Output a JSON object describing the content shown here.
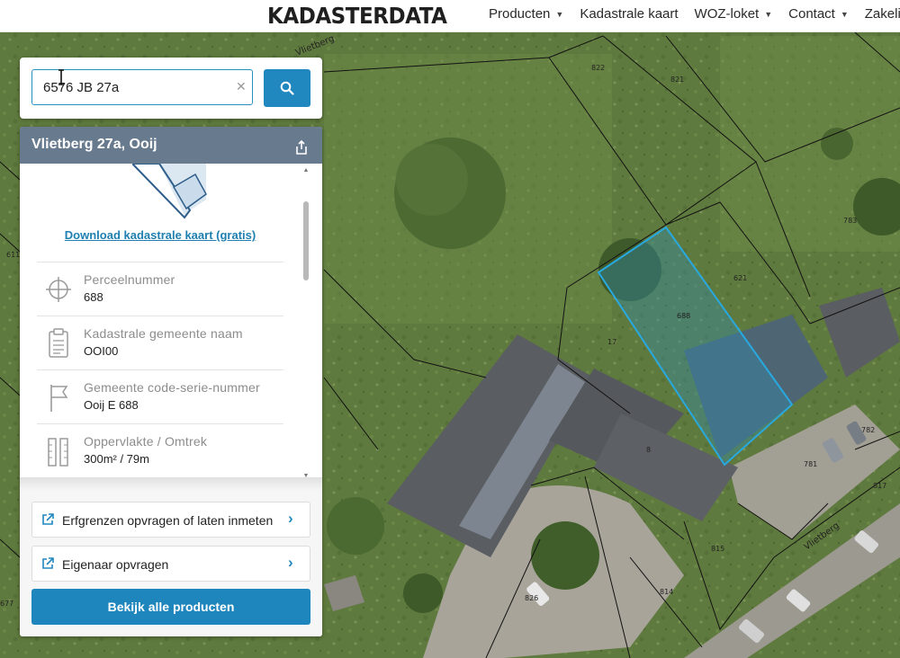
{
  "header": {
    "logo": "KADASTERDATA",
    "nav": [
      {
        "label": "Producten",
        "has_dropdown": true
      },
      {
        "label": "Kadastrale kaart",
        "has_dropdown": false
      },
      {
        "label": "WOZ-loket",
        "has_dropdown": true
      },
      {
        "label": "Contact",
        "has_dropdown": true
      },
      {
        "label": "Zakelijk",
        "has_dropdown": false
      }
    ]
  },
  "search": {
    "value": "6576 JB 27a",
    "clear_icon": "close-icon",
    "button_icon": "search-icon"
  },
  "panel": {
    "title": "Vlietberg 27a, Ooij",
    "share_icon": "share-icon",
    "download_link": "Download kadastrale kaart (gratis)",
    "rows": [
      {
        "icon": "crosshair-icon",
        "label": "Perceelnummer",
        "value": "688"
      },
      {
        "icon": "clipboard-icon",
        "label": "Kadastrale gemeente naam",
        "value": "OOI00"
      },
      {
        "icon": "flag-icon",
        "label": "Gemeente code-serie-nummer",
        "value": "Ooij E 688"
      },
      {
        "icon": "ruler-icon",
        "label": "Oppervlakte / Omtrek",
        "value": "300m² / 79m"
      }
    ],
    "actions": [
      {
        "icon": "external-link-icon",
        "label": "Erfgrenzen opvragen of laten inmeten"
      },
      {
        "icon": "external-link-icon",
        "label": "Eigenaar opvragen"
      }
    ],
    "primary_button": "Bekijk alle producten"
  },
  "map": {
    "street_labels": [
      "Vlietberg",
      "Vlietberg"
    ],
    "parcel_labels": [
      "822",
      "821",
      "783",
      "621",
      "688",
      "782",
      "781",
      "817",
      "815",
      "814",
      "826",
      "611",
      "677",
      "8",
      "17"
    ],
    "colors": {
      "grass": "#5f7a3e",
      "highlight_stroke": "#28a9e0",
      "highlight_fill": "#2f8fb0",
      "accent": "#1f86bd"
    }
  }
}
